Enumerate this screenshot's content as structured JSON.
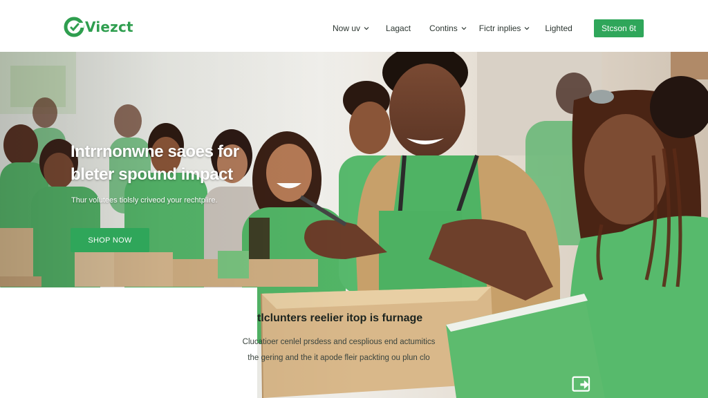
{
  "header": {
    "brand": "Viezct",
    "nav": [
      {
        "label": "Now uv",
        "has_dropdown": true
      },
      {
        "label": "Lagact",
        "has_dropdown": false
      },
      {
        "label": "Contins",
        "has_dropdown": true
      },
      {
        "label": "Fictr inplies",
        "has_dropdown": true
      },
      {
        "label": "Lighted",
        "has_dropdown": false
      }
    ],
    "cta": "Stcson 6t"
  },
  "hero": {
    "title_line1": "Intrrnonwne saoes for",
    "title_line2": "bleter spound impact",
    "subtitle": "Thur volutees tiolsly criveod your rechtplire.",
    "cta": "SHOP NOW"
  },
  "info": {
    "title": "tlclunters reelier itop is furnage",
    "body_line1": "Clucatioer cenlel prsdess and cesplious end actumitics",
    "body_line2": "the gering and the it apode fleir packting ou plun clo"
  },
  "colors": {
    "accent": "#2fa65a",
    "brand": "#2f9e4f",
    "shirt_green": "#52b766"
  },
  "icons": [
    "brand-logo-icon",
    "chevron-down-icon",
    "recycle-box-icon"
  ]
}
